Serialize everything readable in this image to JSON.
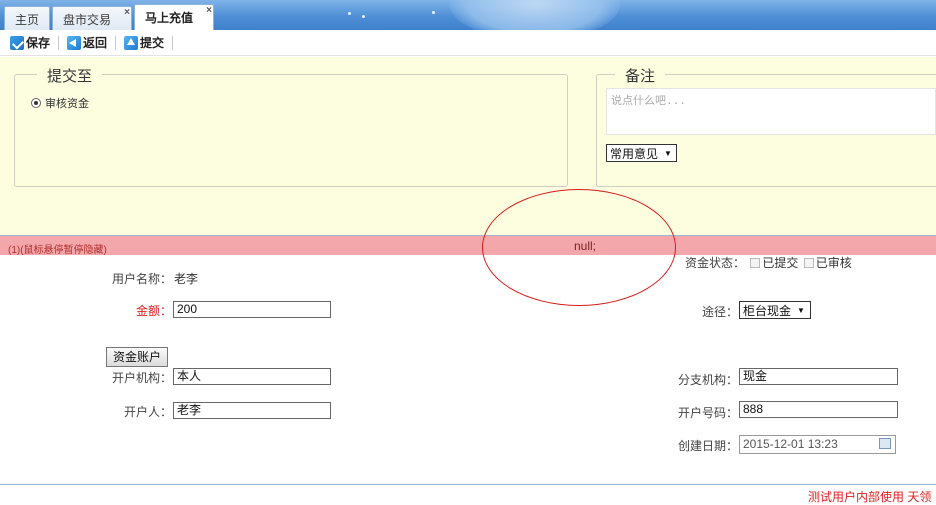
{
  "tabs": [
    {
      "label": "主页",
      "closable": false
    },
    {
      "label": "盘市交易",
      "closable": true
    },
    {
      "label": "马上充值",
      "closable": true,
      "active": true
    }
  ],
  "tab_close_glyph": "×",
  "toolbar": {
    "save_label": "保存",
    "back_label": "返回",
    "submit_label": "提交"
  },
  "submit_to": {
    "legend": "提交至",
    "option_label": "审核资金",
    "selected": true
  },
  "remark": {
    "legend": "备注",
    "placeholder": "说点什么吧...",
    "common_opinion_select": "常用意见"
  },
  "notice_bar": {
    "hint": "(1)(鼠标悬停暂停隐藏)",
    "message": "null;"
  },
  "form": {
    "username_label": "用户名称：",
    "username_value": "老李",
    "amount_label": "金额：",
    "amount_value": "200",
    "fund_status_label": "资金状态：",
    "status_submitted": "已提交",
    "status_audited": "已审核",
    "channel_label": "途径：",
    "channel_value": "柜台现金",
    "account_button": "资金账户",
    "open_org_label": "开户机构：",
    "open_org_value": "本人",
    "branch_label": "分支机构：",
    "branch_value": "现金",
    "account_holder_label": "开户人：",
    "account_holder_value": "老李",
    "account_no_label": "开户号码：",
    "account_no_value": "888",
    "created_label": "创建日期：",
    "created_value": "2015-12-01 13:23"
  },
  "footer": {
    "text": "测试用户内部使用 天领"
  },
  "colors": {
    "tab_bar": "#4e8fd6",
    "yellow_panel": "#fdfde0",
    "notice_bar": "#f4a7aa",
    "required_label": "#e02020",
    "annotation_ellipse": "#d91a1a"
  }
}
